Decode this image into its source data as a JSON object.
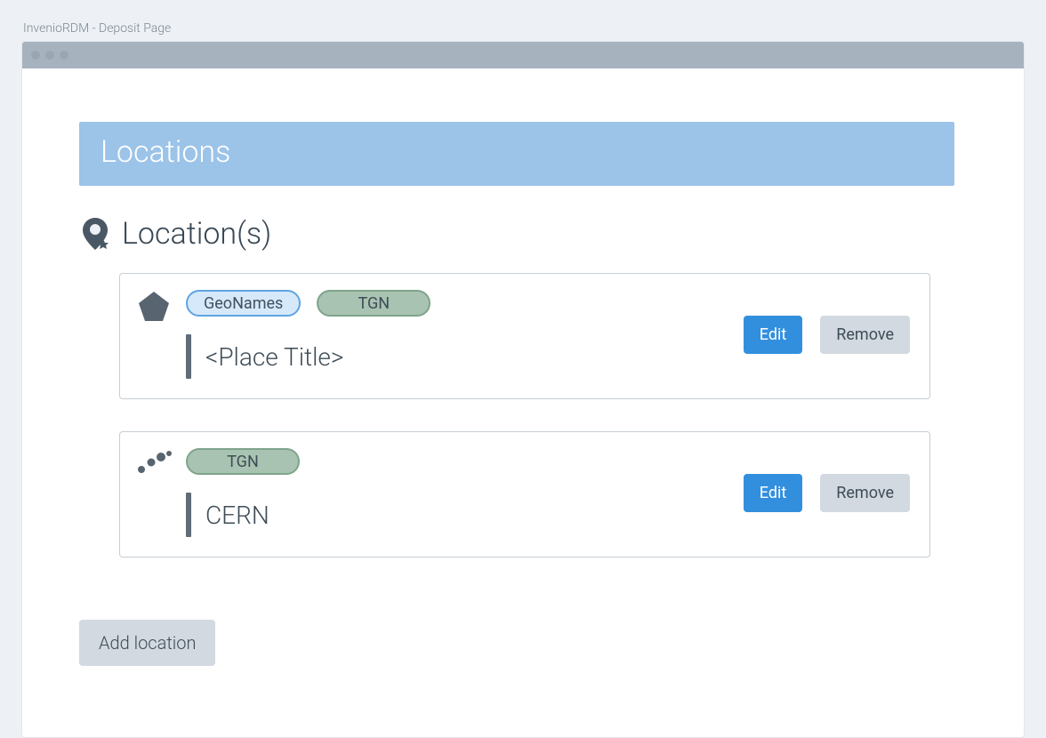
{
  "window": {
    "caption": "InvenioRDM - Deposit Page"
  },
  "panel": {
    "header": "Locations",
    "section_title": "Location(s)"
  },
  "locations": [
    {
      "shape": "pentagon",
      "tags": [
        {
          "label": "GeoNames",
          "style": "blue"
        },
        {
          "label": "TGN",
          "style": "green"
        }
      ],
      "title": "<Place Title>"
    },
    {
      "shape": "dots",
      "tags": [
        {
          "label": "TGN",
          "style": "green"
        }
      ],
      "title": "CERN"
    }
  ],
  "actions": {
    "edit": "Edit",
    "remove": "Remove",
    "add": "Add location"
  }
}
